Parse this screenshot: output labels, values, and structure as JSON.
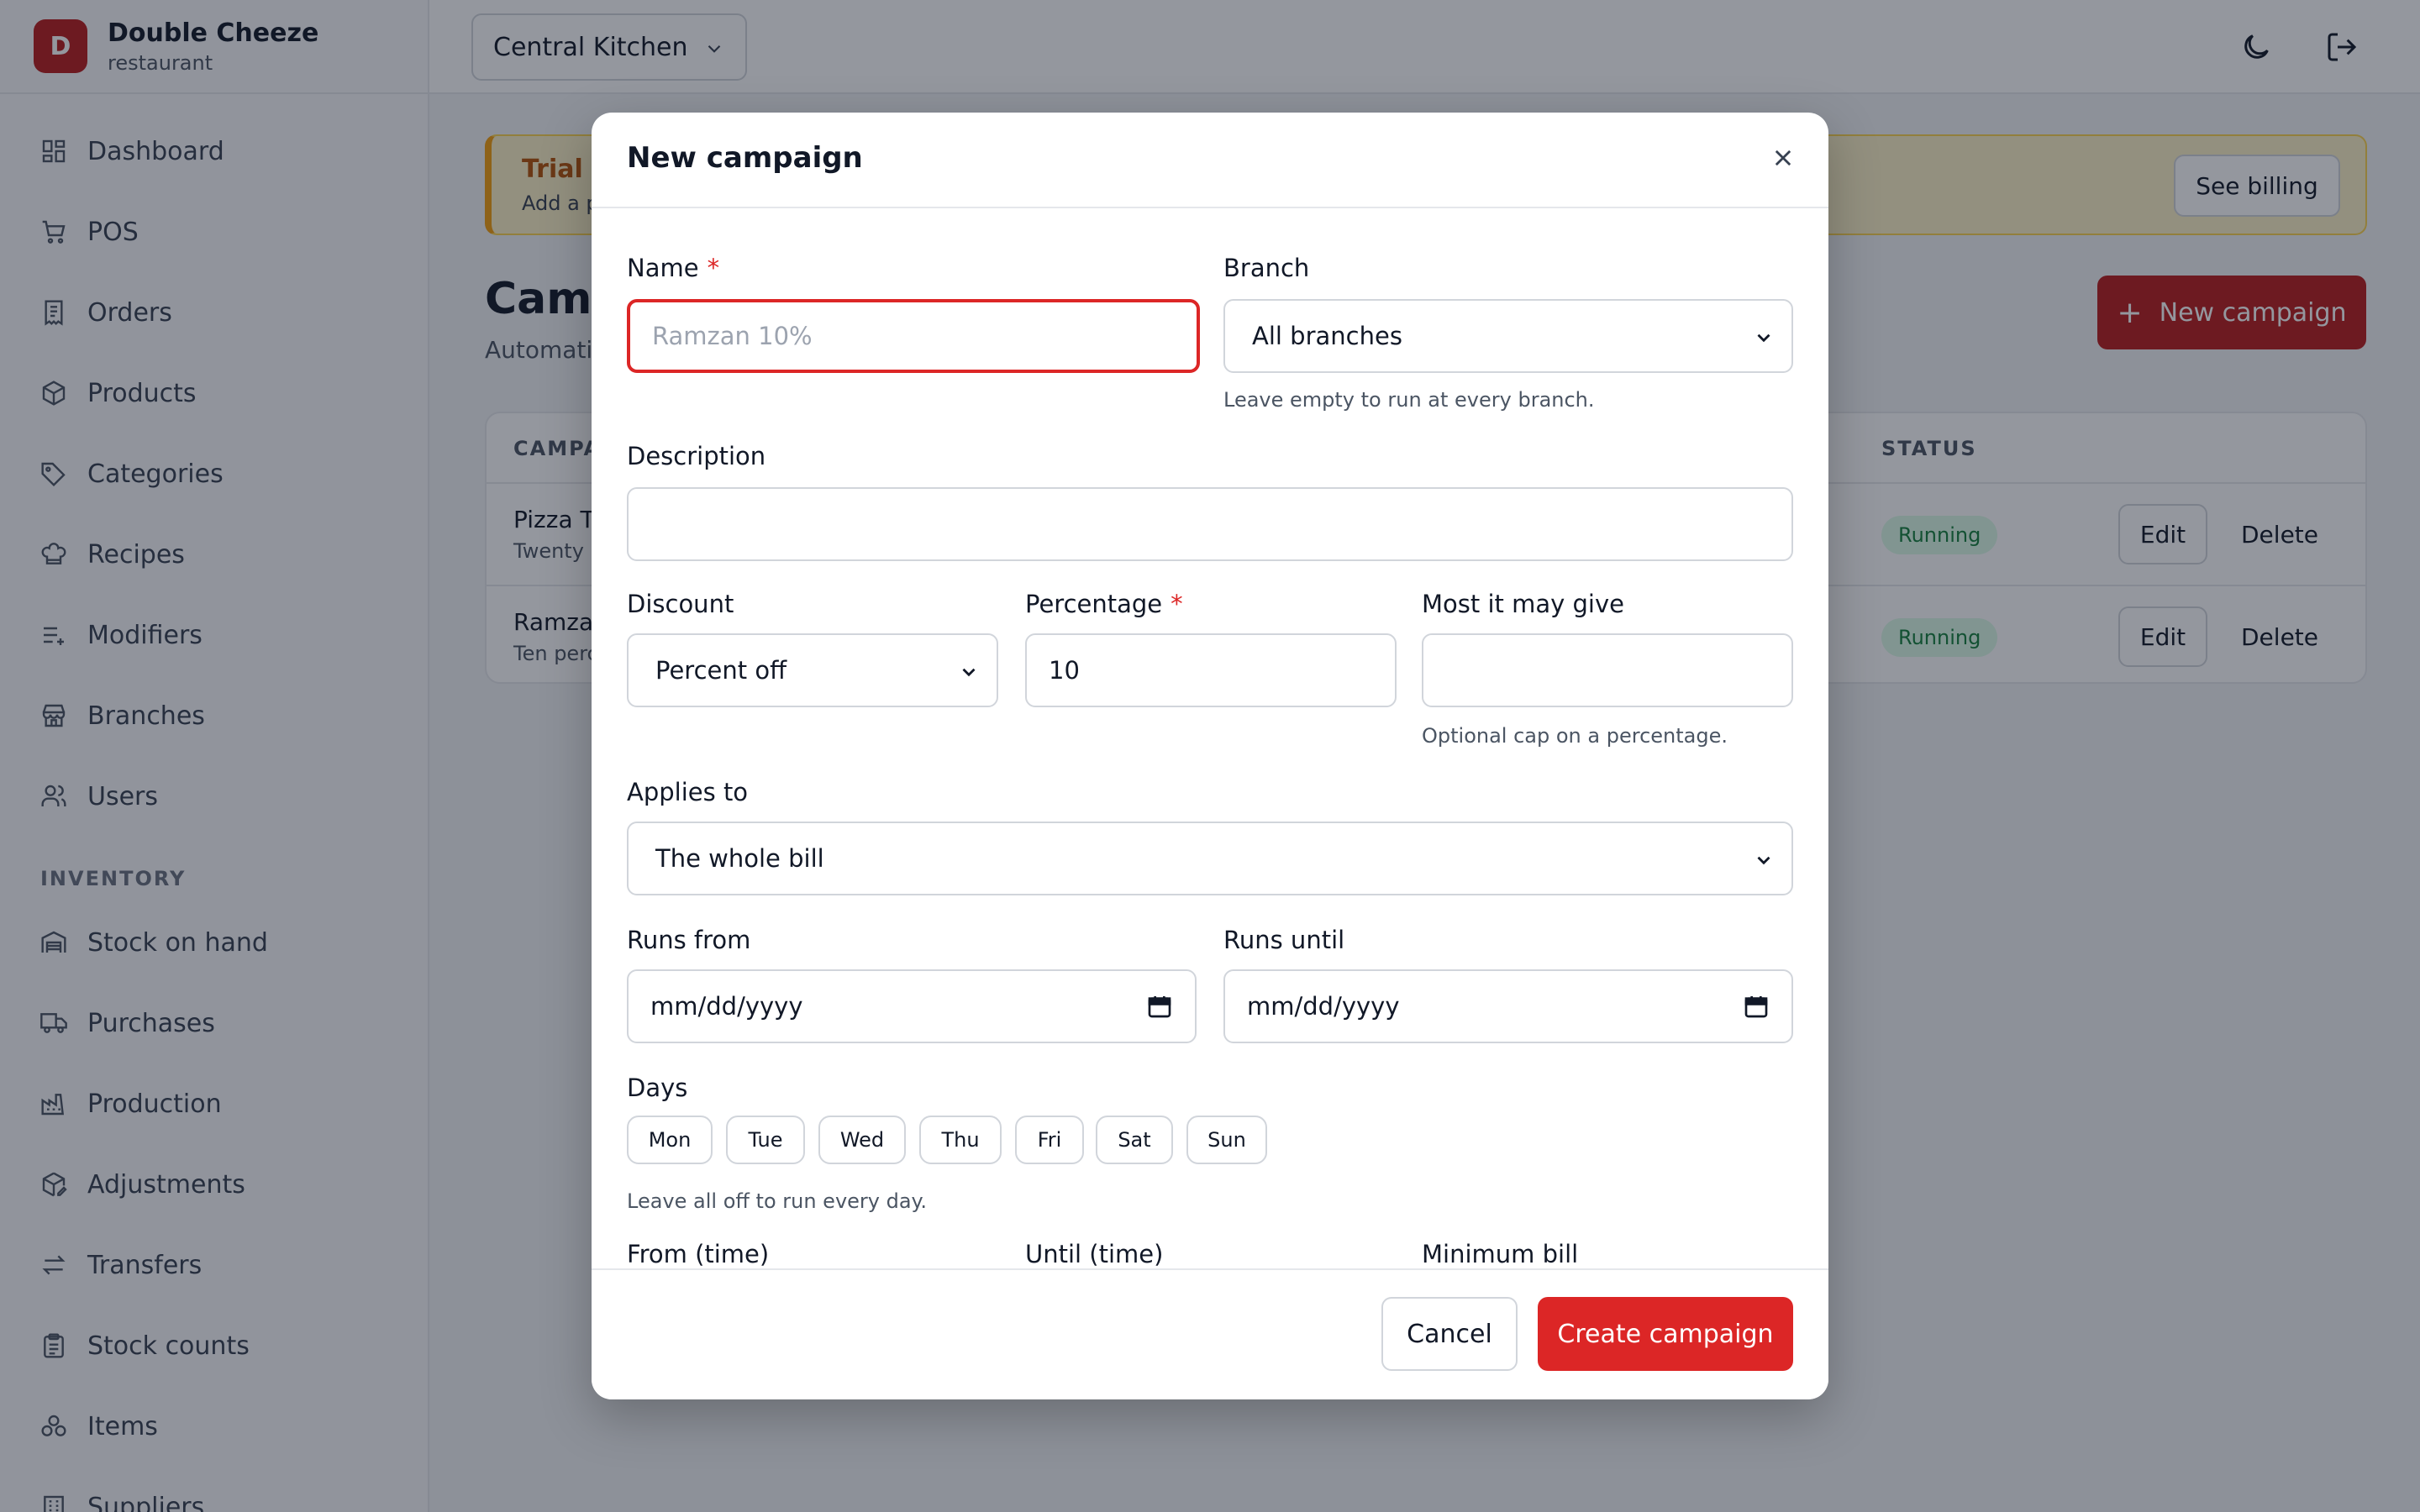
{
  "brand": {
    "initial": "D",
    "name": "Double Cheeze",
    "type": "restaurant"
  },
  "sidebar": {
    "items": [
      {
        "label": "Dashboard",
        "icon": "dashboard-icon"
      },
      {
        "label": "POS",
        "icon": "cart-icon"
      },
      {
        "label": "Orders",
        "icon": "receipt-icon"
      },
      {
        "label": "Products",
        "icon": "package-icon"
      },
      {
        "label": "Categories",
        "icon": "tag-icon"
      },
      {
        "label": "Recipes",
        "icon": "chef-hat-icon"
      },
      {
        "label": "Modifiers",
        "icon": "list-plus-icon"
      },
      {
        "label": "Branches",
        "icon": "store-icon"
      },
      {
        "label": "Users",
        "icon": "users-icon"
      }
    ],
    "inventory_heading": "INVENTORY",
    "inventory_items": [
      {
        "label": "Stock on hand",
        "icon": "warehouse-icon"
      },
      {
        "label": "Purchases",
        "icon": "truck-icon"
      },
      {
        "label": "Production",
        "icon": "factory-icon"
      },
      {
        "label": "Adjustments",
        "icon": "package-edit-icon"
      },
      {
        "label": "Transfers",
        "icon": "arrows-transfer-icon"
      },
      {
        "label": "Stock counts",
        "icon": "clipboard-list-icon"
      },
      {
        "label": "Items",
        "icon": "boxes-icon"
      },
      {
        "label": "Suppliers",
        "icon": "building-icon"
      }
    ]
  },
  "topbar": {
    "branch": "Central Kitchen"
  },
  "trial": {
    "title": "Trial -",
    "subtitle": "Add a p",
    "billing_label": "See billing"
  },
  "page": {
    "title": "Camp",
    "subtitle": "Automati",
    "new_button": "New campaign"
  },
  "table": {
    "col_campaign": "CAMPA",
    "col_status": "STATUS",
    "rows": [
      {
        "name": "Pizza T",
        "desc": "Twenty",
        "status": "Running",
        "edit": "Edit",
        "delete": "Delete"
      },
      {
        "name": "Ramza",
        "desc": "Ten perc",
        "status": "Running",
        "edit": "Edit",
        "delete": "Delete"
      }
    ]
  },
  "modal": {
    "title": "New campaign",
    "name_label": "Name",
    "name_placeholder": "Ramzan 10%",
    "branch_label": "Branch",
    "branch_value": "All branches",
    "branch_hint": "Leave empty to run at every branch.",
    "description_label": "Description",
    "description_value": "",
    "discount_label": "Discount",
    "discount_value": "Percent off",
    "percentage_label": "Percentage",
    "percentage_value": "10",
    "max_label": "Most it may give",
    "max_value": "",
    "max_hint": "Optional cap on a percentage.",
    "applies_label": "Applies to",
    "applies_value": "The whole bill",
    "runs_from_label": "Runs from",
    "runs_from_value": "mm/dd/yyyy",
    "runs_until_label": "Runs until",
    "runs_until_value": "mm/dd/yyyy",
    "days_label": "Days",
    "days": [
      "Mon",
      "Tue",
      "Wed",
      "Thu",
      "Fri",
      "Sat",
      "Sun"
    ],
    "days_hint": "Leave all off to run every day.",
    "from_time_label": "From (time)",
    "until_time_label": "Until (time)",
    "min_bill_label": "Minimum bill",
    "required_mark": "*",
    "cancel_label": "Cancel",
    "create_label": "Create campaign"
  },
  "colors": {
    "primary": "#dc2626",
    "brand": "#b91c1c",
    "running_bg": "#dcfce7",
    "running_text": "#15803d"
  }
}
